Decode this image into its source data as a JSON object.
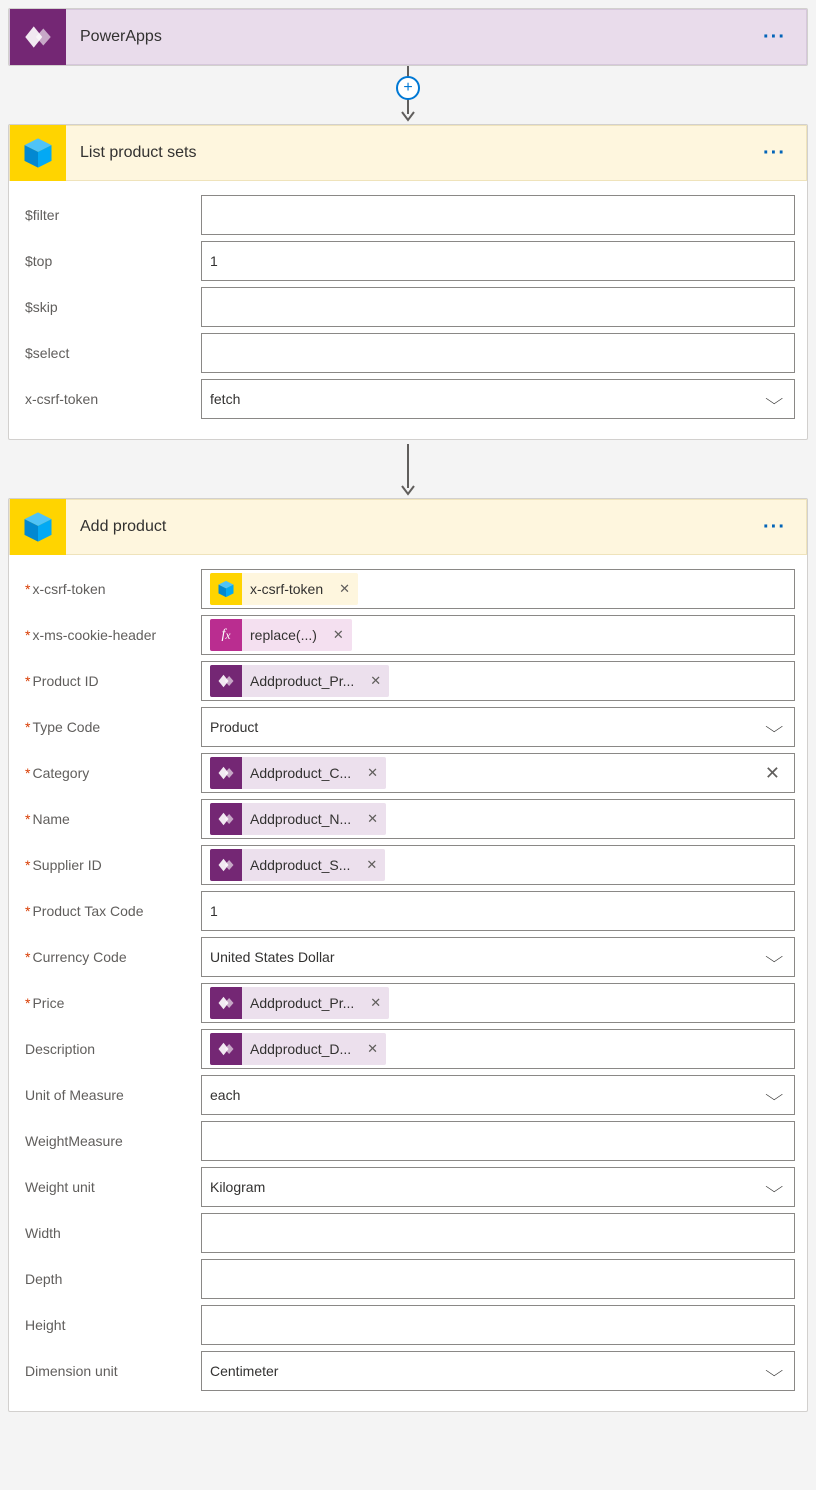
{
  "powerapps": {
    "title": "PowerApps"
  },
  "list_products": {
    "title": "List product sets",
    "fields": {
      "filter": {
        "label": "$filter",
        "value": ""
      },
      "top": {
        "label": "$top",
        "value": "1"
      },
      "skip": {
        "label": "$skip",
        "value": ""
      },
      "select": {
        "label": "$select",
        "value": ""
      },
      "csrf": {
        "label": "x-csrf-token",
        "value": "fetch"
      }
    }
  },
  "add_product": {
    "title": "Add product",
    "fields": {
      "csrf": {
        "label": "x-csrf-token",
        "token": "x-csrf-token"
      },
      "cookie": {
        "label": "x-ms-cookie-header",
        "token": "replace(...)"
      },
      "product_id": {
        "label": "Product ID",
        "token": "Addproduct_Pr..."
      },
      "type_code": {
        "label": "Type Code",
        "value": "Product"
      },
      "category": {
        "label": "Category",
        "token": "Addproduct_C..."
      },
      "name": {
        "label": "Name",
        "token": "Addproduct_N..."
      },
      "supplier_id": {
        "label": "Supplier ID",
        "token": "Addproduct_S..."
      },
      "tax_code": {
        "label": "Product Tax Code",
        "value": "1"
      },
      "currency": {
        "label": "Currency Code",
        "value": "United States Dollar"
      },
      "price": {
        "label": "Price",
        "token": "Addproduct_Pr..."
      },
      "description": {
        "label": "Description",
        "token": "Addproduct_D..."
      },
      "uom": {
        "label": "Unit of Measure",
        "value": "each"
      },
      "weight_measure": {
        "label": "WeightMeasure",
        "value": ""
      },
      "weight_unit": {
        "label": "Weight unit",
        "value": "Kilogram"
      },
      "width": {
        "label": "Width",
        "value": ""
      },
      "depth": {
        "label": "Depth",
        "value": ""
      },
      "height": {
        "label": "Height",
        "value": ""
      },
      "dim_unit": {
        "label": "Dimension unit",
        "value": "Centimeter"
      }
    }
  }
}
